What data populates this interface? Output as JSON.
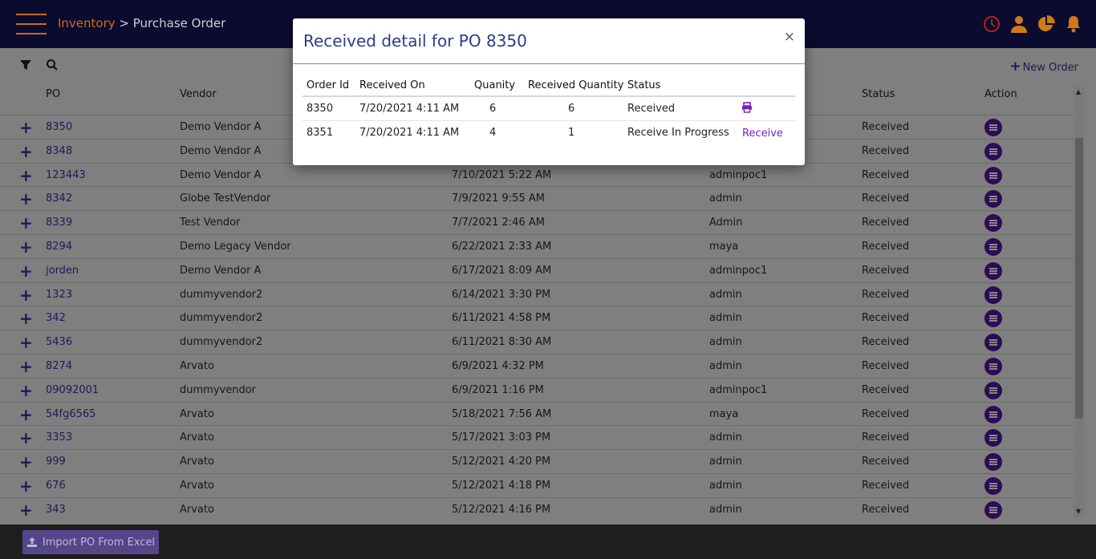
{
  "header": {
    "breadcrumb_link": "Inventory",
    "breadcrumb_sep": " > ",
    "breadcrumb_current": "Purchase Order",
    "icons": [
      "clock-icon",
      "user-icon",
      "pie-chart-icon",
      "bell-icon"
    ],
    "accent_color": "#c96f14"
  },
  "toolbar": {
    "new_order_label": "New Order"
  },
  "grid": {
    "columns": {
      "po": "PO",
      "vendor": "Vendor",
      "status": "Status",
      "action": "Action"
    },
    "rows": [
      {
        "po": "8350",
        "vendor": "Demo Vendor A",
        "date": "",
        "user": "",
        "status": "Received"
      },
      {
        "po": "8348",
        "vendor": "Demo Vendor A",
        "date": "",
        "user": "",
        "status": "Received"
      },
      {
        "po": "123443",
        "vendor": "Demo Vendor A",
        "date": "7/10/2021 5:22 AM",
        "user": "adminpoc1",
        "status": "Received"
      },
      {
        "po": "8342",
        "vendor": "Globe TestVendor",
        "date": "7/9/2021 9:55 AM",
        "user": "admin",
        "status": "Received"
      },
      {
        "po": "8339",
        "vendor": "Test Vendor",
        "date": "7/7/2021 2:46 AM",
        "user": "Admin",
        "status": "Received"
      },
      {
        "po": "8294",
        "vendor": "Demo Legacy Vendor",
        "date": "6/22/2021 2:33 AM",
        "user": "maya",
        "status": "Received"
      },
      {
        "po": "jorden",
        "vendor": "Demo Vendor A",
        "date": "6/17/2021 8:09 AM",
        "user": "adminpoc1",
        "status": "Received"
      },
      {
        "po": "1323",
        "vendor": "dummyvendor2",
        "date": "6/14/2021 3:30 PM",
        "user": "admin",
        "status": "Received"
      },
      {
        "po": "342",
        "vendor": "dummyvendor2",
        "date": "6/11/2021 4:58 PM",
        "user": "admin",
        "status": "Received"
      },
      {
        "po": "5436",
        "vendor": "dummyvendor2",
        "date": "6/11/2021 8:30 AM",
        "user": "admin",
        "status": "Received"
      },
      {
        "po": "8274",
        "vendor": "Arvato",
        "date": "6/9/2021 4:32 PM",
        "user": "admin",
        "status": "Received"
      },
      {
        "po": "09092001",
        "vendor": "dummyvendor",
        "date": "6/9/2021 1:16 PM",
        "user": "adminpoc1",
        "status": "Received"
      },
      {
        "po": "54fg6565",
        "vendor": "Arvato",
        "date": "5/18/2021 7:56 AM",
        "user": "maya",
        "status": "Received"
      },
      {
        "po": "3353",
        "vendor": "Arvato",
        "date": "5/17/2021 3:03 PM",
        "user": "admin",
        "status": "Received"
      },
      {
        "po": "999",
        "vendor": "Arvato",
        "date": "5/12/2021 4:20 PM",
        "user": "admin",
        "status": "Received"
      },
      {
        "po": "676",
        "vendor": "Arvato",
        "date": "5/12/2021 4:18 PM",
        "user": "admin",
        "status": "Received"
      },
      {
        "po": "343",
        "vendor": "Arvato",
        "date": "5/12/2021 4:16 PM",
        "user": "admin",
        "status": "Received"
      }
    ]
  },
  "footer": {
    "import_label": "Import PO From Excel"
  },
  "modal": {
    "title": "Received detail for PO 8350",
    "close_label": "×",
    "columns": {
      "order_id": "Order Id",
      "received_on": "Received On",
      "quantity": "Quanity",
      "received_quantity": "Received Quantity",
      "status": "Status"
    },
    "rows": [
      {
        "order_id": "8350",
        "received_on": "7/20/2021 4:11 AM",
        "quantity": "6",
        "received_quantity": "6",
        "status": "Received",
        "action": "print-icon"
      },
      {
        "order_id": "8351",
        "received_on": "7/20/2021 4:11 AM",
        "quantity": "4",
        "received_quantity": "1",
        "status": "Receive In Progress",
        "action_label": "Receive"
      }
    ],
    "title_color": "#2c3b8c",
    "link_color": "#7a20c8"
  }
}
